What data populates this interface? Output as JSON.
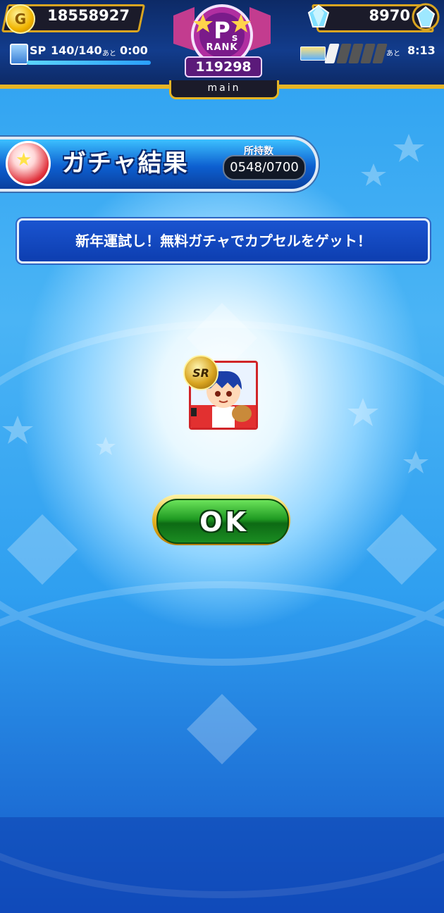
{
  "header": {
    "coins": "18558927",
    "sp_label": "SP",
    "sp_value": "140/140",
    "sp_ato": "あと",
    "sp_time": "0:00",
    "rank_label": "RANK",
    "rank_value": "119298",
    "mode_tab": "main",
    "gems": "8970",
    "stamina_ato": "あと",
    "stamina_time": "8:13",
    "stamina_segments_filled": 1,
    "stamina_segments_total": 5
  },
  "result": {
    "title": "ガチャ結果",
    "owned_label": "所持数",
    "owned_value": "0548/0700"
  },
  "message": "新年運試し！無料ガチャでカプセルをゲット！",
  "card": {
    "rarity": "SR"
  },
  "ok_button": "OK",
  "colors": {
    "header_bg": "#123c8c",
    "gold": "#e6b425",
    "ok_green": "#1f9a22",
    "banner_blue": "#0d3eb0",
    "card_border": "#d02428"
  }
}
